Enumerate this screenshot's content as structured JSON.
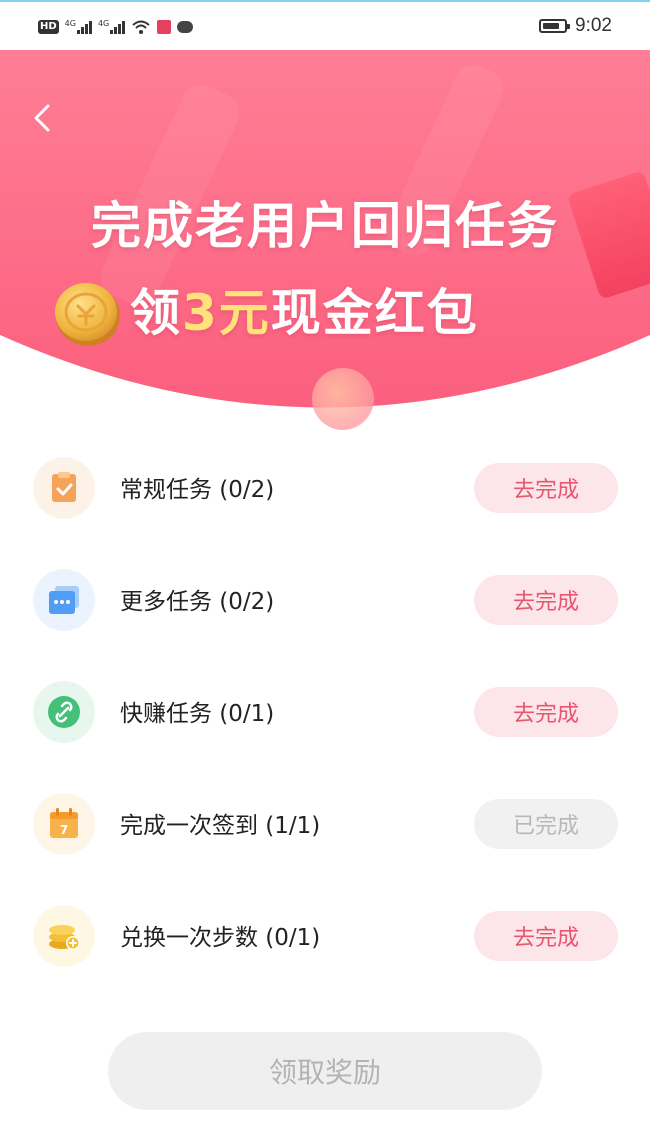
{
  "status_bar": {
    "left_labels": {
      "hd": "HD",
      "net1": "4G",
      "net2": "4G"
    },
    "time": "9:02",
    "battery_level": 0.8
  },
  "banner": {
    "headline": "完成老用户回归任务",
    "sub_prefix": "领",
    "sub_amount": "3元",
    "sub_suffix": "现金红包",
    "colors": {
      "top": "#ff7e95",
      "bottom": "#fb5f7e",
      "amount": "#ffe27a"
    }
  },
  "tasks": [
    {
      "label": "常规任务 (0/2)",
      "button": "去完成",
      "status": "todo",
      "icon": "clipboard-check-icon",
      "icon_bg": "#fdf2e8",
      "icon_color": "#f5a35a"
    },
    {
      "label": "更多任务 (0/2)",
      "button": "去完成",
      "status": "todo",
      "icon": "chat-bubble-icon",
      "icon_bg": "#eaf3fe",
      "icon_color": "#4f9df5"
    },
    {
      "label": "快赚任务 (0/1)",
      "button": "去完成",
      "status": "todo",
      "icon": "link-icon",
      "icon_bg": "#e8f7ee",
      "icon_color": "#45c07a"
    },
    {
      "label": "完成一次签到 (1/1)",
      "button": "已完成",
      "status": "done",
      "icon": "calendar-icon",
      "icon_bg": "#fef5e6",
      "icon_color": "#f7b24c",
      "icon_text": "7"
    },
    {
      "label": "兑换一次步数 (0/1)",
      "button": "去完成",
      "status": "todo",
      "icon": "coin-stack-icon",
      "icon_bg": "#fef7e3",
      "icon_color": "#f4bf35"
    }
  ],
  "claim_button": "领取奖励"
}
